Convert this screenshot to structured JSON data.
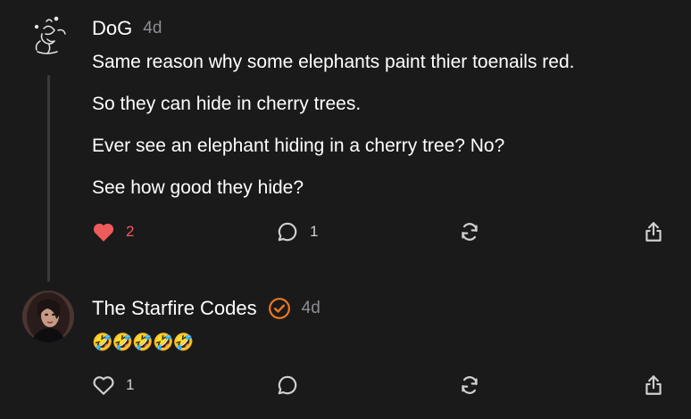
{
  "posts": [
    {
      "author": "DoG",
      "time": "4d",
      "avatar_icon": "dog-sketch-avatar",
      "body": [
        "Same reason why some elephants paint thier toenails red.",
        "So they can hide in cherry trees.",
        "Ever see an elephant hiding in a cherry tree? No?",
        "See how good they hide?"
      ],
      "likes": "2",
      "liked": true,
      "replies": "1"
    },
    {
      "author": "The Starfire Codes",
      "time": "4d",
      "verified": true,
      "avatar_icon": "profile-photo-avatar",
      "body_emoji": "🤣🤣🤣🤣🤣",
      "likes": "1",
      "liked": false,
      "replies": ""
    }
  ],
  "colors": {
    "background": "#1a1a1b",
    "like_active": "#ef5b5b",
    "verified": "#f07a1e",
    "muted": "#8e8e93",
    "icon": "#d0d0d0"
  }
}
